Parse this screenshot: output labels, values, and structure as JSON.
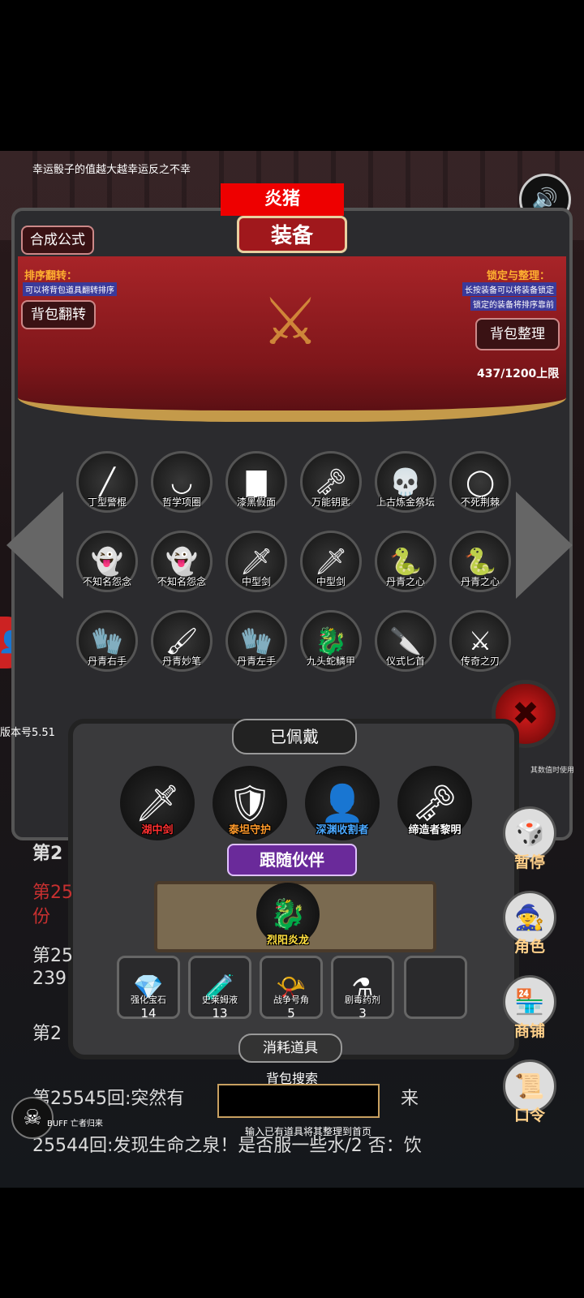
{
  "hint": "幸运骰子的值越大越幸运反之不幸",
  "red_tag": "炎猪",
  "title": "装备",
  "buttons": {
    "synth": "合成公式",
    "flip": "背包翻转",
    "sort": "背包整理"
  },
  "left_tip": {
    "title": "排序翻转：",
    "desc": "可以将背包道具翻转排序"
  },
  "right_tip": {
    "title": "锁定与整理：",
    "desc1": "长按装备可以将装备锁定",
    "desc2": "锁定的装备将排序靠前"
  },
  "capacity": "437/1200上限",
  "version": "版本号5.51",
  "items": [
    {
      "label": "丁型警棍",
      "icon": "baton-icon"
    },
    {
      "label": "哲学项圈",
      "icon": "collar-icon"
    },
    {
      "label": "漆黑假面",
      "icon": "mask-icon"
    },
    {
      "label": "万能钥匙",
      "icon": "key-icon"
    },
    {
      "label": "上古炼金祭坛",
      "icon": "skull-altar-icon"
    },
    {
      "label": "不死荆棘",
      "icon": "thorn-wreath-icon"
    },
    {
      "label": "不知名怨念",
      "icon": "ghost-icon"
    },
    {
      "label": "不知名怨念",
      "icon": "ghost-icon"
    },
    {
      "label": "中型剑",
      "icon": "sword-icon"
    },
    {
      "label": "中型剑",
      "icon": "sword-icon"
    },
    {
      "label": "丹青之心",
      "icon": "serpent-icon"
    },
    {
      "label": "丹青之心",
      "icon": "serpent-icon"
    },
    {
      "label": "丹青右手",
      "icon": "glove-icon"
    },
    {
      "label": "丹青妙笔",
      "icon": "brush-icon"
    },
    {
      "label": "丹青左手",
      "icon": "glove-icon"
    },
    {
      "label": "九头蛇鳞甲",
      "icon": "hydra-armor-icon"
    },
    {
      "label": "仪式匕首",
      "icon": "dagger-icon"
    },
    {
      "label": "传奇之刃",
      "icon": "blade-icon"
    }
  ],
  "equipped_title": "已佩戴",
  "equipped": [
    {
      "label": "湖中剑",
      "color": "#ff3030"
    },
    {
      "label": "泰坦守护",
      "color": "#ff9a2a"
    },
    {
      "label": "深渊收割者",
      "color": "#4aa8ff"
    },
    {
      "label": "缔造者黎明",
      "color": "#ffffff"
    }
  ],
  "companion_title": "跟随伙伴",
  "companion": {
    "label": "烈阳炎龙"
  },
  "consumables": [
    {
      "label": "强化宝石",
      "count": "14"
    },
    {
      "label": "史莱姆液",
      "count": "13"
    },
    {
      "label": "战争号角",
      "count": "5"
    },
    {
      "label": "剧毒药剂",
      "count": "3"
    }
  ],
  "consumables_title": "消耗道具",
  "search": {
    "title": "背包搜索",
    "hint": "输入已有道具将其整理到首页"
  },
  "side": [
    {
      "label": "暂停",
      "icon": "dice-icon"
    },
    {
      "label": "角色",
      "icon": "hood-icon"
    },
    {
      "label": "商铺",
      "icon": "shop-icon"
    },
    {
      "label": "口令",
      "icon": "scroll-icon"
    }
  ],
  "log": {
    "l1": "第2",
    "l2": "第25",
    "l3": "份",
    "l4": "第25",
    "l5": "239",
    "l6": "第2",
    "l7": "第25545回:突然有",
    "l7b": "来",
    "l8": "25544回:发现生命之泉！是否服一些水/2 否：饮"
  },
  "buff": "BUFF 亡者归来",
  "right_note": "其数值时使用"
}
